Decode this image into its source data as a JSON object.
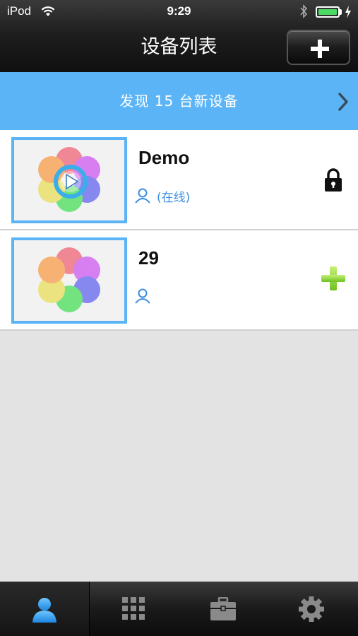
{
  "status_bar": {
    "carrier": "iPod",
    "time": "9:29"
  },
  "nav": {
    "title": "设备列表"
  },
  "banner": {
    "text": "发现 15 台新设备"
  },
  "devices": [
    {
      "name": "Demo",
      "status": "(在线)",
      "action_icon": "lock-icon"
    },
    {
      "name": "29",
      "status": "",
      "action_icon": "add-green-icon"
    }
  ],
  "colors": {
    "accent": "#5bb4f6",
    "online_text": "#3b8ee0",
    "battery": "#4cd964",
    "tab_active": "#3aa0f0"
  },
  "tabs": [
    {
      "icon": "person-icon",
      "active": true
    },
    {
      "icon": "grid-icon",
      "active": false
    },
    {
      "icon": "toolbox-icon",
      "active": false
    },
    {
      "icon": "gear-icon",
      "active": false
    }
  ]
}
